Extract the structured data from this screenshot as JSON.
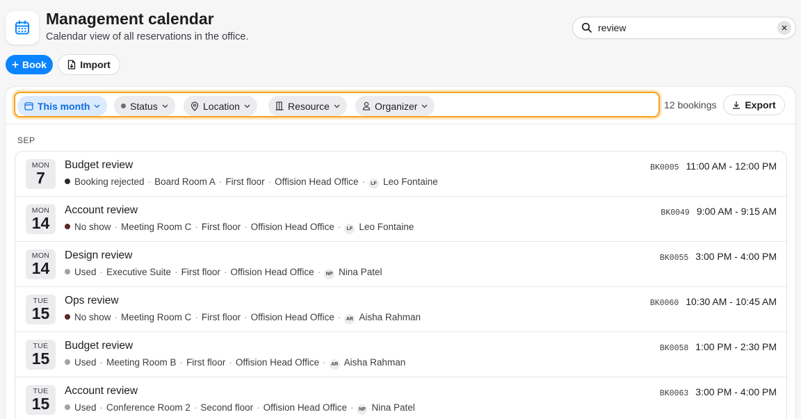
{
  "header": {
    "title": "Management calendar",
    "subtitle": "Calendar view of all reservations in the office."
  },
  "search": {
    "value": "review",
    "icon": "search-icon",
    "clear_icon": "close-icon"
  },
  "actions": {
    "book_label": "Book",
    "book_icon": "plus-icon",
    "import_label": "Import",
    "import_icon": "file-import-icon"
  },
  "filters": {
    "month": "This month",
    "status": "Status",
    "location": "Location",
    "resource": "Resource",
    "organizer": "Organizer"
  },
  "summary": {
    "count": "12 bookings",
    "export_label": "Export"
  },
  "colors": {
    "accent": "#0a84ff",
    "filter_highlight": "#f5a11c",
    "status_rejected": "#2b2b2e",
    "status_no_show": "#5a2a24",
    "status_used": "#a1a1a6"
  },
  "month_label": "SEP",
  "bookings": [
    {
      "dow": "MON",
      "day": "7",
      "title": "Budget review",
      "status": "Booking rejected",
      "status_color": "#2b2b2e",
      "room": "Board Room A",
      "floor": "First floor",
      "office": "Offision Head Office",
      "initials": "LF",
      "organizer": "Leo Fontaine",
      "code": "BK0005",
      "time": "11:00 AM - 12:00 PM"
    },
    {
      "dow": "MON",
      "day": "14",
      "title": "Account review",
      "status": "No show",
      "status_color": "#5a2a24",
      "room": "Meeting Room C",
      "floor": "First floor",
      "office": "Offision Head Office",
      "initials": "LF",
      "organizer": "Leo Fontaine",
      "code": "BK0049",
      "time": "9:00 AM - 9:15 AM"
    },
    {
      "dow": "MON",
      "day": "14",
      "title": "Design review",
      "status": "Used",
      "status_color": "#a1a1a6",
      "room": "Executive Suite",
      "floor": "First floor",
      "office": "Offision Head Office",
      "initials": "NP",
      "organizer": "Nina Patel",
      "code": "BK0055",
      "time": "3:00 PM - 4:00 PM"
    },
    {
      "dow": "TUE",
      "day": "15",
      "title": "Ops review",
      "status": "No show",
      "status_color": "#5a2a24",
      "room": "Meeting Room C",
      "floor": "First floor",
      "office": "Offision Head Office",
      "initials": "AR",
      "organizer": "Aisha Rahman",
      "code": "BK0060",
      "time": "10:30 AM - 10:45 AM"
    },
    {
      "dow": "TUE",
      "day": "15",
      "title": "Budget review",
      "status": "Used",
      "status_color": "#a1a1a6",
      "room": "Meeting Room B",
      "floor": "First floor",
      "office": "Offision Head Office",
      "initials": "AR",
      "organizer": "Aisha Rahman",
      "code": "BK0058",
      "time": "1:00 PM - 2:30 PM"
    },
    {
      "dow": "TUE",
      "day": "15",
      "title": "Account review",
      "status": "Used",
      "status_color": "#a1a1a6",
      "room": "Conference Room 2",
      "floor": "Second floor",
      "office": "Offision Head Office",
      "initials": "NP",
      "organizer": "Nina Patel",
      "code": "BK0063",
      "time": "3:00 PM - 4:00 PM"
    }
  ]
}
